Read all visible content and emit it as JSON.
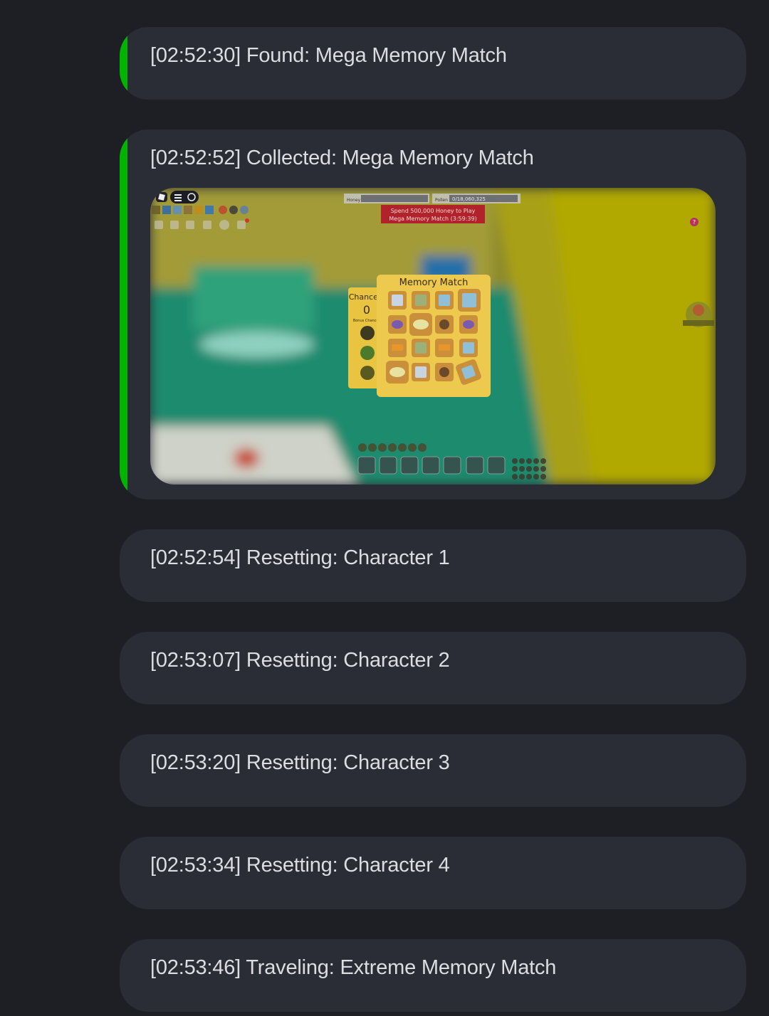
{
  "messages": [
    {
      "text": "[02:52:30] Found: Mega Memory Match",
      "accent": "#00b400"
    },
    {
      "text": "[02:52:52] Collected: Mega Memory Match",
      "accent": "#00b400"
    },
    {
      "text": "[02:52:54] Resetting: Character 1"
    },
    {
      "text": "[02:53:07] Resetting: Character 2"
    },
    {
      "text": "[02:53:20] Resetting: Character 3"
    },
    {
      "text": "[02:53:34] Resetting: Character 4"
    },
    {
      "text": "[02:53:46] Traveling: Extreme Memory Match"
    }
  ],
  "screenshot": {
    "game_title": "Memory Match",
    "chances_label": "Chances:",
    "chances_value": "0",
    "bonus_label": "Bonus Chances",
    "honey_label": "Honey",
    "pollen_label": "Pollen",
    "pollen_value": "0/18,060,325",
    "banner_line1": "Spend 500,000 Honey to Play",
    "banner_line2": "Mega Memory Match (3:59:39)"
  },
  "colors": {
    "background": "#1e1f24",
    "card": "#2b2d36",
    "accent_green": "#00b400",
    "text": "#dcdde3"
  }
}
